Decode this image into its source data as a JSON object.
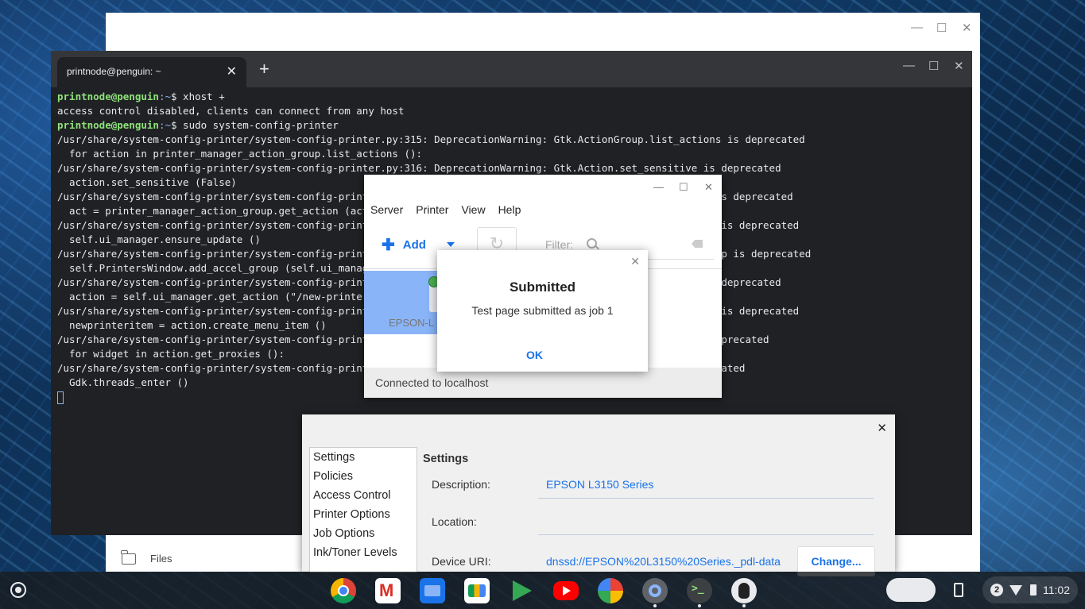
{
  "terminal": {
    "tab_title": "printnode@penguin: ~",
    "tab_close": "✕",
    "new_tab": "+",
    "lines": [
      {
        "user": "printnode@penguin",
        "path": ":~",
        "text": "$ xhost +"
      },
      {
        "text": "access control disabled, clients can connect from any host"
      },
      {
        "user": "printnode@penguin",
        "path": ":~",
        "text": "$ sudo system-config-printer"
      },
      {
        "text": "/usr/share/system-config-printer/system-config-printer.py:315: DeprecationWarning: Gtk.ActionGroup.list_actions is deprecated"
      },
      {
        "text": "  for action in printer_manager_action_group.list_actions ():"
      },
      {
        "text": "/usr/share/system-config-printer/system-config-printer.py:316: DeprecationWarning: Gtk.Action.set_sensitive is deprecated"
      },
      {
        "text": "  action.set_sensitive (False)"
      },
      {
        "text": "/usr/share/system-config-printer/system-config-printer.py:318: DeprecationWarning: Gtk.ActionGroup.get_action is deprecated"
      },
      {
        "text": "  act = printer_manager_action_group.get_action (action)"
      },
      {
        "text": "/usr/share/system-config-printer/system-config-printer.py:350: DeprecationWarning: Gtk.UIManager.ensure_update is deprecated"
      },
      {
        "text": "  self.ui_manager.ensure_update ()"
      },
      {
        "text": "/usr/share/system-config-printer/system-config-printer.py:351: DeprecationWarning: Gtk.UIManager.get_accel_group is deprecated"
      },
      {
        "text": "  self.PrintersWindow.add_accel_group (self.ui_manager.get_accel_group ())"
      },
      {
        "text": "/usr/share/system-config-printer/system-config-printer.py:362: DeprecationWarning: Gtk.UIManager.get_action is deprecated"
      },
      {
        "text": "  action = self.ui_manager.get_action (\"/new-printer\")"
      },
      {
        "text": "/usr/share/system-config-printer/system-config-printer.py:363: DeprecationWarning: Gtk.Action.create_menu_item is deprecated"
      },
      {
        "text": "  newprinteritem = action.create_menu_item ()"
      },
      {
        "text": "/usr/share/system-config-printer/system-config-printer.py:370: DeprecationWarning: Gtk.Action.get_proxies is deprecated"
      },
      {
        "text": "  for widget in action.get_proxies ():"
      },
      {
        "text": "/usr/share/system-config-printer/system-config-printer.py:1631: DeprecationWarning: Gdk.threads_enter is deprecated"
      },
      {
        "text": "  Gdk.threads_enter ()"
      }
    ]
  },
  "back_window": {
    "files_label": "Files"
  },
  "printer_window": {
    "menu": [
      "Server",
      "Printer",
      "View",
      "Help"
    ],
    "add_label": "Add",
    "filter_label": "Filter:",
    "printer_name": "EPSON-L",
    "status": "Connected to localhost"
  },
  "dialog": {
    "title": "Submitted",
    "message": "Test page submitted as job 1",
    "ok_label": "OK",
    "close": "✕"
  },
  "properties": {
    "close": "✕",
    "nav": [
      "Settings",
      "Policies",
      "Access Control",
      "Printer Options",
      "Job Options",
      "Ink/Toner Levels"
    ],
    "heading": "Settings",
    "description_label": "Description:",
    "description_value": "EPSON L3150 Series",
    "location_label": "Location:",
    "location_value": "",
    "device_uri_label": "Device URI:",
    "device_uri_value": "dnssd://EPSON%20L3150%20Series._pdl-data",
    "change_label": "Change..."
  },
  "shelf": {
    "apps": [
      "chrome-icon",
      "gmail-icon",
      "files-app-icon",
      "meet-icon",
      "play-store-icon",
      "youtube-icon",
      "photos-icon",
      "settings-icon",
      "terminal-icon",
      "penguin-icon"
    ],
    "notification_count": "2",
    "time": "11:02"
  }
}
